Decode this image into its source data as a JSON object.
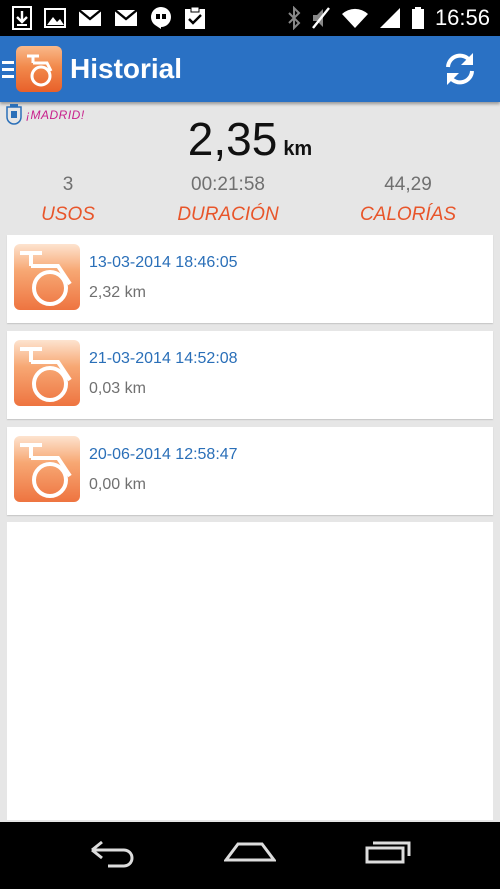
{
  "status_bar": {
    "time": "16:56",
    "icons_left": [
      "download-icon",
      "image-icon",
      "gmail-icon",
      "gmail-icon",
      "hangouts-icon",
      "clipboard-check-icon"
    ],
    "icons_right": [
      "bluetooth-icon",
      "mute-icon",
      "wifi-icon",
      "signal-icon",
      "battery-icon"
    ]
  },
  "app_bar": {
    "title": "Historial",
    "icons": [
      "menu-icon",
      "bike-logo-icon",
      "refresh-icon"
    ]
  },
  "summary": {
    "madrid_logo_text": "¡MADRID!",
    "distance": "2,35",
    "distance_unit": "km",
    "stats": [
      {
        "value": "3",
        "label": "USOS"
      },
      {
        "value": "00:21:58",
        "label": "DURACIÓN"
      },
      {
        "value": "44,29",
        "label": "CALORÍAS"
      }
    ]
  },
  "history": [
    {
      "date": "13-03-2014 18:46:05",
      "distance": "2,32 km"
    },
    {
      "date": "21-03-2014 14:52:08",
      "distance": "0,03 km"
    },
    {
      "date": "20-06-2014 12:58:47",
      "distance": "0,00 km"
    }
  ],
  "colors": {
    "app_bar": "#2a71c4",
    "accent_label": "#e8552a",
    "date_text": "#2a6fb8",
    "madrid_pink": "#c8208c"
  },
  "nav_bar": {
    "icons": [
      "back-icon",
      "home-icon",
      "recents-icon"
    ]
  }
}
